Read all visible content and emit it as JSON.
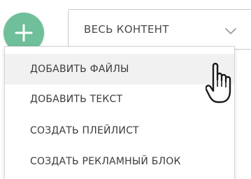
{
  "add_button": {
    "icon": "plus-icon",
    "color": "#6fbf9a"
  },
  "filter": {
    "selected": "ВЕСЬ КОНТЕНТ",
    "icon": "chevron-down-icon"
  },
  "menu": {
    "items": [
      {
        "label": "ДОБАВИТЬ ФАЙЛЫ",
        "hovered": true
      },
      {
        "label": "ДОБАВИТЬ ТЕКСТ"
      },
      {
        "label": "СОЗДАТЬ ПЛЕЙЛИСТ"
      },
      {
        "label": "СОЗДАТЬ РЕКЛАМНЫЙ БЛОК"
      }
    ]
  },
  "cursor": {
    "icon": "hand-pointer-icon"
  }
}
